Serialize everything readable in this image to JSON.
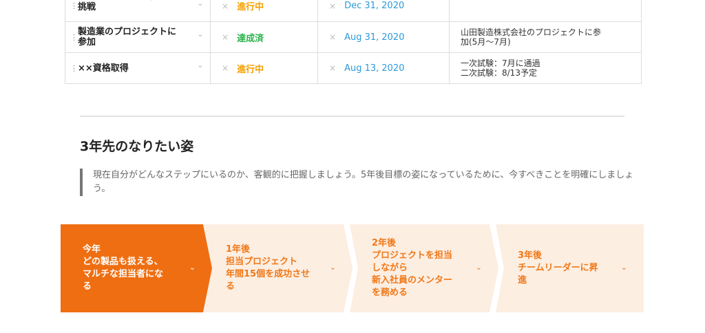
{
  "goals_table": {
    "rows": [
      {
        "title": "プロジェクトリーダーに\n挑戦",
        "status": "進行中",
        "status_type": "progress",
        "date": "Dec 31, 2020",
        "note": ""
      },
      {
        "title": "製造業のプロジェクトに\n参加",
        "status": "達成済",
        "status_type": "done",
        "date": "Aug 31, 2020",
        "note": "山田製造株式会社のプロジェクトに参\n加(5月～7月)"
      },
      {
        "title": "××資格取得",
        "status": "進行中",
        "status_type": "progress",
        "date": "Aug 13, 2020",
        "note": "一次試験：7月に通過\n二次試験：8/13予定"
      }
    ]
  },
  "section": {
    "heading": "3年先のなりたい姿",
    "description": "現在自分がどんなステップにいるのか、客観的に把握しましょう。5年後目標の姿になっているために、今すべきことを明確にしましょう。"
  },
  "steps": [
    {
      "label": "今年\nどの製品も扱える、\nマルチな担当者にな\nる"
    },
    {
      "label": "1年後\n担当プロジェクト\n年間15個を成功させ\nる"
    },
    {
      "label": "2年後\nプロジェクトを担当\nしながら\n新入社員のメンター\nを務める"
    },
    {
      "label": "3年後\nチームリーダーに昇\n進"
    }
  ],
  "colors": {
    "accent": "#ef6e12",
    "step_bg": "#fdeee2",
    "status_progress": "#f5a000",
    "status_done": "#2bb24c",
    "date": "#2b9ad9"
  },
  "icons": {
    "drag": "drag-handle-icon",
    "chevron": "chevron-down-icon",
    "clear": "clear-x-icon"
  }
}
